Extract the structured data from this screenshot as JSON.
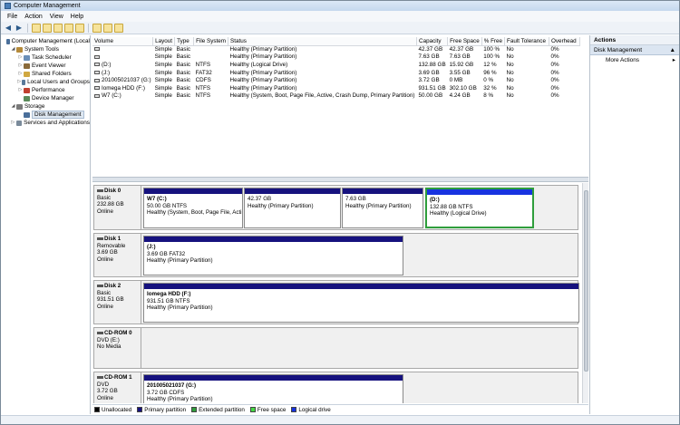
{
  "window": {
    "title": "Computer Management"
  },
  "menu": [
    "File",
    "Action",
    "View",
    "Help"
  ],
  "tree": [
    {
      "label": "Computer Management (Local",
      "indent": 0,
      "expander": "",
      "color": "#4a6f9a"
    },
    {
      "label": "System Tools",
      "indent": 1,
      "expander": "◢",
      "color": "#b58a3a"
    },
    {
      "label": "Task Scheduler",
      "indent": 2,
      "expander": "▷",
      "color": "#6a8fb8"
    },
    {
      "label": "Event Viewer",
      "indent": 2,
      "expander": "▷",
      "color": "#8a6a3a"
    },
    {
      "label": "Shared Folders",
      "indent": 2,
      "expander": "▷",
      "color": "#d0a840"
    },
    {
      "label": "Local Users and Groups",
      "indent": 2,
      "expander": "▷",
      "color": "#5a7a9a"
    },
    {
      "label": "Performance",
      "indent": 2,
      "expander": "▷",
      "color": "#c04030"
    },
    {
      "label": "Device Manager",
      "indent": 2,
      "expander": "",
      "color": "#5a8a5a"
    },
    {
      "label": "Storage",
      "indent": 1,
      "expander": "◢",
      "color": "#7a7a7a"
    },
    {
      "label": "Disk Management",
      "indent": 2,
      "expander": "",
      "color": "#4a6f9a",
      "selected": true
    },
    {
      "label": "Services and Applications",
      "indent": 1,
      "expander": "▷",
      "color": "#7a8a9a"
    }
  ],
  "volume_table": {
    "columns": [
      "Volume",
      "Layout",
      "Type",
      "File System",
      "Status",
      "Capacity",
      "Free Space",
      "% Free",
      "Fault Tolerance",
      "Overhead"
    ],
    "rows": [
      [
        "",
        "Simple",
        "Basic",
        "",
        "Healthy (Primary Partition)",
        "42.37 GB",
        "42.37 GB",
        "100 %",
        "No",
        "0%"
      ],
      [
        "",
        "Simple",
        "Basic",
        "",
        "Healthy (Primary Partition)",
        "7.63 GB",
        "7.63 GB",
        "100 %",
        "No",
        "0%"
      ],
      [
        "(D:)",
        "Simple",
        "Basic",
        "NTFS",
        "Healthy (Logical Drive)",
        "132.88 GB",
        "15.92 GB",
        "12 %",
        "No",
        "0%"
      ],
      [
        "(J:)",
        "Simple",
        "Basic",
        "FAT32",
        "Healthy (Primary Partition)",
        "3.69 GB",
        "3.55 GB",
        "96 %",
        "No",
        "0%"
      ],
      [
        "201005021037 (G:)",
        "Simple",
        "Basic",
        "CDFS",
        "Healthy (Primary Partition)",
        "3.72 GB",
        "0 MB",
        "0 %",
        "No",
        "0%"
      ],
      [
        "Iomega HDD (F:)",
        "Simple",
        "Basic",
        "NTFS",
        "Healthy (Primary Partition)",
        "931.51 GB",
        "302.10 GB",
        "32 %",
        "No",
        "0%"
      ],
      [
        "W7 (C:)",
        "Simple",
        "Basic",
        "NTFS",
        "Healthy (System, Boot, Page File, Active, Crash Dump, Primary Partition)",
        "50.00 GB",
        "4.24 GB",
        "8 %",
        "No",
        "0%"
      ]
    ]
  },
  "disks": [
    {
      "name": "Disk 0",
      "kind": "Basic",
      "size": "232.88 GB",
      "state": "Online",
      "partitions": [
        {
          "name": "W7  (C:)",
          "size": "50.00 GB NTFS",
          "status": "Healthy (System, Boot, Page File, Acti"
        },
        {
          "name": "",
          "size": "42.37 GB",
          "status": "Healthy (Primary Partition)"
        },
        {
          "name": "",
          "size": "7.63 GB",
          "status": "Healthy (Primary Partition)"
        },
        {
          "name": "(D:)",
          "size": "132.88 GB NTFS",
          "status": "Healthy (Logical Drive)",
          "selected": true
        }
      ]
    },
    {
      "name": "Disk 1",
      "kind": "Removable",
      "size": "3.69 GB",
      "state": "Online",
      "partitions": [
        {
          "name": "(J:)",
          "size": "3.69 GB FAT32",
          "status": "Healthy (Primary Partition)"
        }
      ]
    },
    {
      "name": "Disk 2",
      "kind": "Basic",
      "size": "931.51 GB",
      "state": "Online",
      "partitions": [
        {
          "name": "Iomega HDD  (F:)",
          "size": "931.51 GB NTFS",
          "status": "Healthy (Primary Partition)"
        }
      ]
    },
    {
      "name": "CD-ROM 0",
      "kind": "DVD (E:)",
      "size": "",
      "state": "No Media",
      "partitions": []
    },
    {
      "name": "CD-ROM 1",
      "kind": "DVD",
      "size": "3.72 GB",
      "state": "Online",
      "partitions": [
        {
          "name": "201005021037  (G:)",
          "size": "3.72 GB CDFS",
          "status": "Healthy (Primary Partition)"
        }
      ]
    }
  ],
  "legend": [
    {
      "label": "Unallocated",
      "color": "#000000"
    },
    {
      "label": "Primary partition",
      "color": "#16127e"
    },
    {
      "label": "Extended partition",
      "color": "#2f9e3c"
    },
    {
      "label": "Free space",
      "color": "#44d844"
    },
    {
      "label": "Logical drive",
      "color": "#1733e0"
    }
  ],
  "actions": {
    "header": "Actions",
    "section": "Disk Management",
    "items": [
      "More Actions"
    ]
  }
}
